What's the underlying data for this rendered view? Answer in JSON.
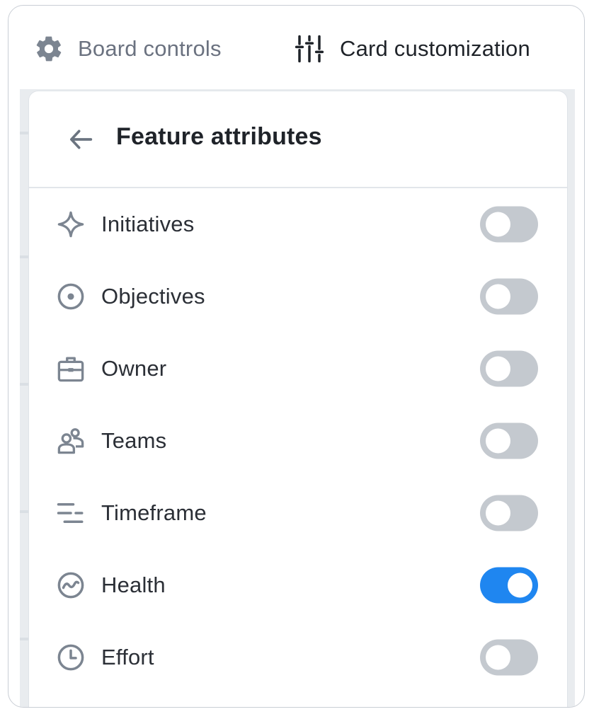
{
  "tabs": {
    "board_controls": {
      "label": "Board controls",
      "icon": "gear-icon"
    },
    "card_customization": {
      "label": "Card customization",
      "icon": "sliders-icon"
    }
  },
  "panel": {
    "title": "Feature attributes",
    "back_icon": "arrow-left-icon",
    "attributes": [
      {
        "label": "Initiatives",
        "icon": "sparkle-icon",
        "enabled": false
      },
      {
        "label": "Objectives",
        "icon": "target-icon",
        "enabled": false
      },
      {
        "label": "Owner",
        "icon": "briefcase-icon",
        "enabled": false
      },
      {
        "label": "Teams",
        "icon": "team-icon",
        "enabled": false
      },
      {
        "label": "Timeframe",
        "icon": "timeframe-icon",
        "enabled": false
      },
      {
        "label": "Health",
        "icon": "health-icon",
        "enabled": true
      },
      {
        "label": "Effort",
        "icon": "clock-icon",
        "enabled": false
      }
    ]
  },
  "colors": {
    "toggle_on": "#1f86f0",
    "toggle_off": "#c4c9cf",
    "icon_gray": "#7c8591",
    "text_dark": "#1f2329"
  }
}
